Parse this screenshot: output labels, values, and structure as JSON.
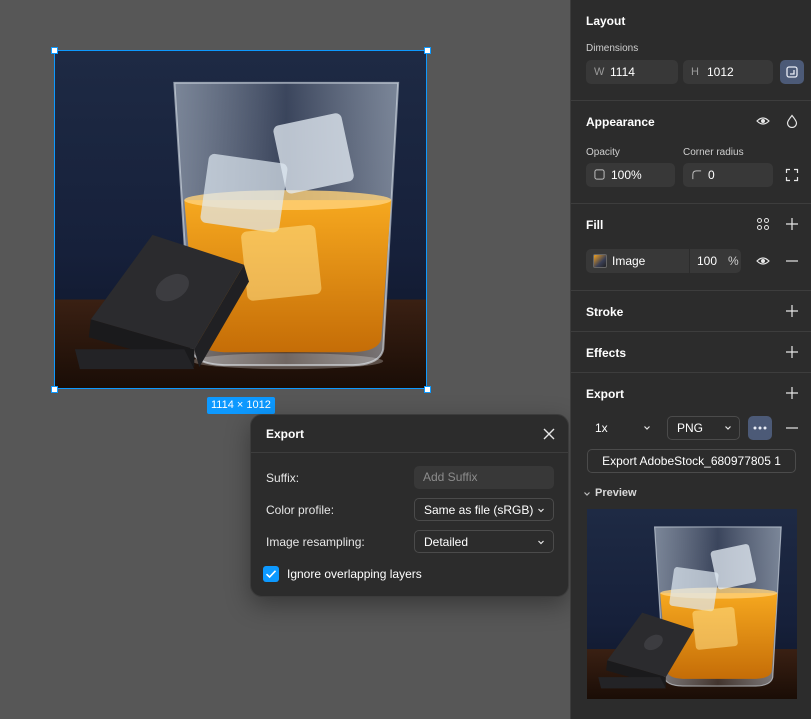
{
  "canvas": {
    "selection_size": "1114 × 1012"
  },
  "export_dialog": {
    "title": "Export",
    "suffix_label": "Suffix:",
    "suffix_placeholder": "Add Suffix",
    "color_profile_label": "Color profile:",
    "color_profile_value": "Same as file (sRGB)",
    "resampling_label": "Image resampling:",
    "resampling_value": "Detailed",
    "ignore_overlapping_label": "Ignore overlapping layers",
    "ignore_overlapping_checked": true
  },
  "panel": {
    "layout": {
      "title": "Layout",
      "dimensions_label": "Dimensions",
      "w_prefix": "W",
      "w_value": "1114",
      "h_prefix": "H",
      "h_value": "1012"
    },
    "appearance": {
      "title": "Appearance",
      "opacity_label": "Opacity",
      "opacity_value": "100%",
      "corner_radius_label": "Corner radius",
      "corner_radius_value": "0"
    },
    "fill": {
      "title": "Fill",
      "type": "Image",
      "opacity_value": "100",
      "opacity_unit": "%"
    },
    "stroke": {
      "title": "Stroke"
    },
    "effects": {
      "title": "Effects"
    },
    "export": {
      "title": "Export",
      "scale": "1x",
      "format": "PNG",
      "export_button_label": "Export AdobeStock_680977805 1",
      "preview_label": "Preview"
    }
  },
  "colors": {
    "accent": "#0d99ff",
    "panel_bg": "#2c2c2c",
    "canvas_bg": "#575757"
  }
}
